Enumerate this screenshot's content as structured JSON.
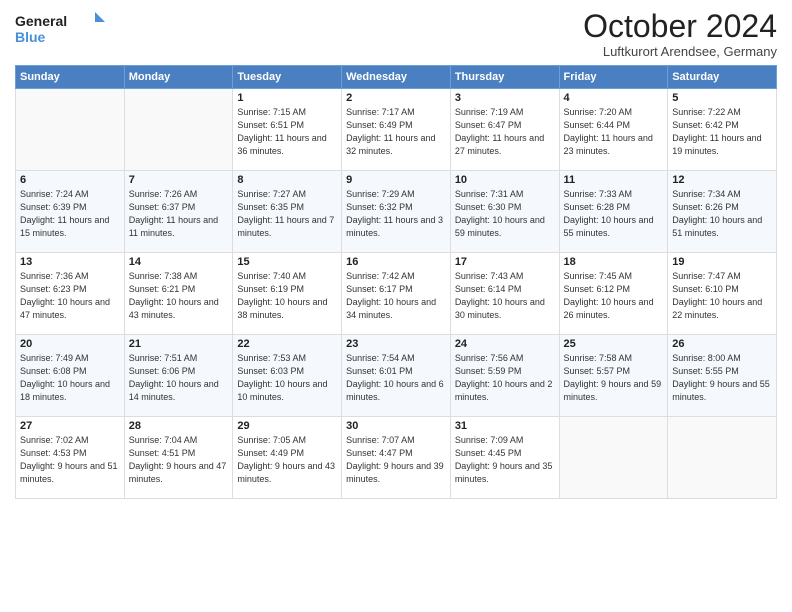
{
  "header": {
    "logo_line1": "General",
    "logo_line2": "Blue",
    "month": "October 2024",
    "location": "Luftkurort Arendsee, Germany"
  },
  "days_of_week": [
    "Sunday",
    "Monday",
    "Tuesday",
    "Wednesday",
    "Thursday",
    "Friday",
    "Saturday"
  ],
  "weeks": [
    [
      {
        "day": "",
        "sunrise": "",
        "sunset": "",
        "daylight": ""
      },
      {
        "day": "",
        "sunrise": "",
        "sunset": "",
        "daylight": ""
      },
      {
        "day": "1",
        "sunrise": "Sunrise: 7:15 AM",
        "sunset": "Sunset: 6:51 PM",
        "daylight": "Daylight: 11 hours and 36 minutes."
      },
      {
        "day": "2",
        "sunrise": "Sunrise: 7:17 AM",
        "sunset": "Sunset: 6:49 PM",
        "daylight": "Daylight: 11 hours and 32 minutes."
      },
      {
        "day": "3",
        "sunrise": "Sunrise: 7:19 AM",
        "sunset": "Sunset: 6:47 PM",
        "daylight": "Daylight: 11 hours and 27 minutes."
      },
      {
        "day": "4",
        "sunrise": "Sunrise: 7:20 AM",
        "sunset": "Sunset: 6:44 PM",
        "daylight": "Daylight: 11 hours and 23 minutes."
      },
      {
        "day": "5",
        "sunrise": "Sunrise: 7:22 AM",
        "sunset": "Sunset: 6:42 PM",
        "daylight": "Daylight: 11 hours and 19 minutes."
      }
    ],
    [
      {
        "day": "6",
        "sunrise": "Sunrise: 7:24 AM",
        "sunset": "Sunset: 6:39 PM",
        "daylight": "Daylight: 11 hours and 15 minutes."
      },
      {
        "day": "7",
        "sunrise": "Sunrise: 7:26 AM",
        "sunset": "Sunset: 6:37 PM",
        "daylight": "Daylight: 11 hours and 11 minutes."
      },
      {
        "day": "8",
        "sunrise": "Sunrise: 7:27 AM",
        "sunset": "Sunset: 6:35 PM",
        "daylight": "Daylight: 11 hours and 7 minutes."
      },
      {
        "day": "9",
        "sunrise": "Sunrise: 7:29 AM",
        "sunset": "Sunset: 6:32 PM",
        "daylight": "Daylight: 11 hours and 3 minutes."
      },
      {
        "day": "10",
        "sunrise": "Sunrise: 7:31 AM",
        "sunset": "Sunset: 6:30 PM",
        "daylight": "Daylight: 10 hours and 59 minutes."
      },
      {
        "day": "11",
        "sunrise": "Sunrise: 7:33 AM",
        "sunset": "Sunset: 6:28 PM",
        "daylight": "Daylight: 10 hours and 55 minutes."
      },
      {
        "day": "12",
        "sunrise": "Sunrise: 7:34 AM",
        "sunset": "Sunset: 6:26 PM",
        "daylight": "Daylight: 10 hours and 51 minutes."
      }
    ],
    [
      {
        "day": "13",
        "sunrise": "Sunrise: 7:36 AM",
        "sunset": "Sunset: 6:23 PM",
        "daylight": "Daylight: 10 hours and 47 minutes."
      },
      {
        "day": "14",
        "sunrise": "Sunrise: 7:38 AM",
        "sunset": "Sunset: 6:21 PM",
        "daylight": "Daylight: 10 hours and 43 minutes."
      },
      {
        "day": "15",
        "sunrise": "Sunrise: 7:40 AM",
        "sunset": "Sunset: 6:19 PM",
        "daylight": "Daylight: 10 hours and 38 minutes."
      },
      {
        "day": "16",
        "sunrise": "Sunrise: 7:42 AM",
        "sunset": "Sunset: 6:17 PM",
        "daylight": "Daylight: 10 hours and 34 minutes."
      },
      {
        "day": "17",
        "sunrise": "Sunrise: 7:43 AM",
        "sunset": "Sunset: 6:14 PM",
        "daylight": "Daylight: 10 hours and 30 minutes."
      },
      {
        "day": "18",
        "sunrise": "Sunrise: 7:45 AM",
        "sunset": "Sunset: 6:12 PM",
        "daylight": "Daylight: 10 hours and 26 minutes."
      },
      {
        "day": "19",
        "sunrise": "Sunrise: 7:47 AM",
        "sunset": "Sunset: 6:10 PM",
        "daylight": "Daylight: 10 hours and 22 minutes."
      }
    ],
    [
      {
        "day": "20",
        "sunrise": "Sunrise: 7:49 AM",
        "sunset": "Sunset: 6:08 PM",
        "daylight": "Daylight: 10 hours and 18 minutes."
      },
      {
        "day": "21",
        "sunrise": "Sunrise: 7:51 AM",
        "sunset": "Sunset: 6:06 PM",
        "daylight": "Daylight: 10 hours and 14 minutes."
      },
      {
        "day": "22",
        "sunrise": "Sunrise: 7:53 AM",
        "sunset": "Sunset: 6:03 PM",
        "daylight": "Daylight: 10 hours and 10 minutes."
      },
      {
        "day": "23",
        "sunrise": "Sunrise: 7:54 AM",
        "sunset": "Sunset: 6:01 PM",
        "daylight": "Daylight: 10 hours and 6 minutes."
      },
      {
        "day": "24",
        "sunrise": "Sunrise: 7:56 AM",
        "sunset": "Sunset: 5:59 PM",
        "daylight": "Daylight: 10 hours and 2 minutes."
      },
      {
        "day": "25",
        "sunrise": "Sunrise: 7:58 AM",
        "sunset": "Sunset: 5:57 PM",
        "daylight": "Daylight: 9 hours and 59 minutes."
      },
      {
        "day": "26",
        "sunrise": "Sunrise: 8:00 AM",
        "sunset": "Sunset: 5:55 PM",
        "daylight": "Daylight: 9 hours and 55 minutes."
      }
    ],
    [
      {
        "day": "27",
        "sunrise": "Sunrise: 7:02 AM",
        "sunset": "Sunset: 4:53 PM",
        "daylight": "Daylight: 9 hours and 51 minutes."
      },
      {
        "day": "28",
        "sunrise": "Sunrise: 7:04 AM",
        "sunset": "Sunset: 4:51 PM",
        "daylight": "Daylight: 9 hours and 47 minutes."
      },
      {
        "day": "29",
        "sunrise": "Sunrise: 7:05 AM",
        "sunset": "Sunset: 4:49 PM",
        "daylight": "Daylight: 9 hours and 43 minutes."
      },
      {
        "day": "30",
        "sunrise": "Sunrise: 7:07 AM",
        "sunset": "Sunset: 4:47 PM",
        "daylight": "Daylight: 9 hours and 39 minutes."
      },
      {
        "day": "31",
        "sunrise": "Sunrise: 7:09 AM",
        "sunset": "Sunset: 4:45 PM",
        "daylight": "Daylight: 9 hours and 35 minutes."
      },
      {
        "day": "",
        "sunrise": "",
        "sunset": "",
        "daylight": ""
      },
      {
        "day": "",
        "sunrise": "",
        "sunset": "",
        "daylight": ""
      }
    ]
  ]
}
